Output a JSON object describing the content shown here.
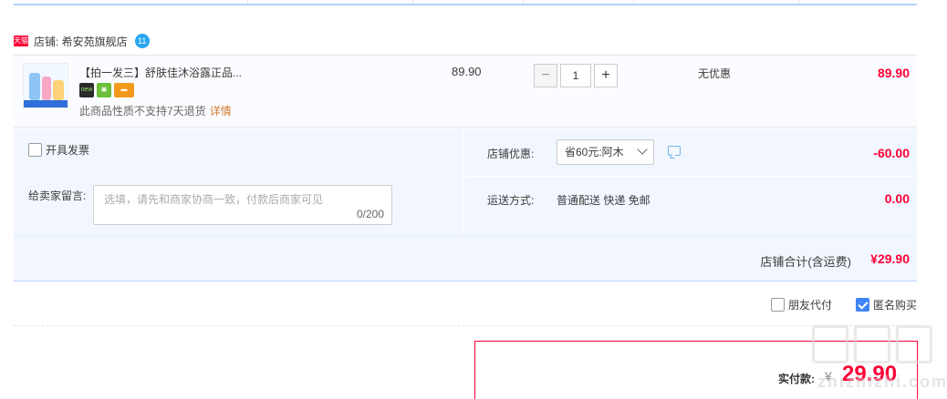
{
  "store": {
    "platform_icon": "天猫",
    "label": "店铺: 希安苑旗舰店",
    "wangwang_icon": "11"
  },
  "item": {
    "title": "【拍一发三】舒肤佳沐浴露正品...",
    "badges": [
      "new",
      "gift",
      "card"
    ],
    "return_note": "此商品性质不支持7天退货",
    "detail_link": "详情",
    "unit_price": "89.90",
    "quantity": "1",
    "qty_minus": "−",
    "qty_plus": "+",
    "discount": "无优惠",
    "total": "89.90"
  },
  "options": {
    "invoice_label": "开具发票",
    "message_label": "给卖家留言:",
    "message_placeholder": "选填，请先和商家协商一致，付款后商家可见",
    "message_count": "0/200",
    "coupon_label": "店铺优惠:",
    "coupon_selected": "省60元:阿木",
    "coupon_amount": "-60.00",
    "shipping_label": "运送方式:",
    "shipping_value": "普通配送 快递 免邮",
    "shipping_amount": "0.00",
    "subtotal_label": "店铺合计(含运费)",
    "subtotal_value": "¥29.90"
  },
  "payment_options": {
    "friend_pay": "朋友代付",
    "friend_pay_checked": false,
    "anonymous": "匿名购买",
    "anonymous_checked": true
  },
  "payment": {
    "label": "实付款:",
    "currency": "¥",
    "amount": "29.90"
  },
  "watermark": {
    "text": "zhizhizhi.com"
  },
  "colors": {
    "accent": "#ff0036",
    "link": "#cf7b2f",
    "panel": "#f2f7ff",
    "checkbox": "#3d84f5"
  }
}
